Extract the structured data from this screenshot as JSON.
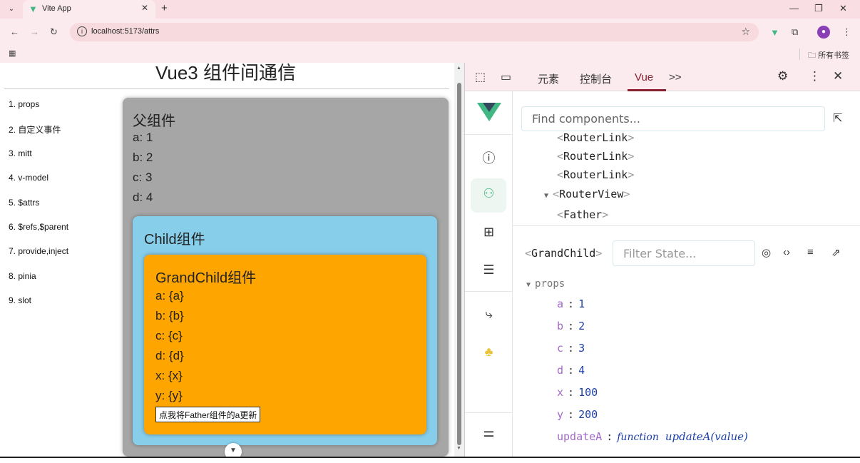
{
  "browser": {
    "tab_title": "Vite App",
    "url": "localhost:5173/attrs",
    "bookmarks_folder": "所有书签",
    "window_controls": [
      "—",
      "❐",
      "✕"
    ]
  },
  "page": {
    "title": "Vue3 组件间通信",
    "nav": [
      "1. props",
      "2. 自定义事件",
      "3. mitt",
      "4. v-model",
      "5. $attrs",
      "6. $refs,$parent",
      "7. provide,inject",
      "8. pinia",
      "9. slot"
    ],
    "father": {
      "heading": "父组件",
      "rows": [
        "a: 1",
        "b: 2",
        "c: 3",
        "d: 4"
      ]
    },
    "child": {
      "heading": "Child组件"
    },
    "grandchild": {
      "heading": "GrandChild组件",
      "rows": [
        "a: {a}",
        "b: {b}",
        "c: {c}",
        "d: {d}",
        "x: {x}",
        "y: {y}"
      ],
      "button": "点我将Father组件的a更新"
    }
  },
  "devtools": {
    "tabs": [
      "元素",
      "控制台",
      "Vue"
    ],
    "active_tab": "Vue",
    "more": ">>",
    "search_placeholder": "Find components...",
    "tree": [
      {
        "name": "RouterLink"
      },
      {
        "name": "RouterLink"
      },
      {
        "name": "RouterLink"
      },
      {
        "name": "RouterView"
      },
      {
        "name": "Father"
      }
    ],
    "inspector": {
      "component": "GrandChild",
      "filter_placeholder": "Filter State...",
      "section": "props",
      "props": [
        {
          "key": "a",
          "value": "1"
        },
        {
          "key": "b",
          "value": "2"
        },
        {
          "key": "c",
          "value": "3"
        },
        {
          "key": "d",
          "value": "4"
        },
        {
          "key": "x",
          "value": "100"
        },
        {
          "key": "y",
          "value": "200"
        }
      ],
      "fn_prop": {
        "key": "updateA",
        "kind": "function",
        "signature": "updateA(value)"
      }
    },
    "colors": {
      "vue_green": "#41b883",
      "active_tab": "#8a1f2f",
      "prop_key": "#a36ac7",
      "prop_value": "#1c3ea8"
    }
  },
  "colors": {
    "father_bg": "#a6a6a6",
    "child_bg": "#87ceeb",
    "grandchild_bg": "#ffa500"
  }
}
